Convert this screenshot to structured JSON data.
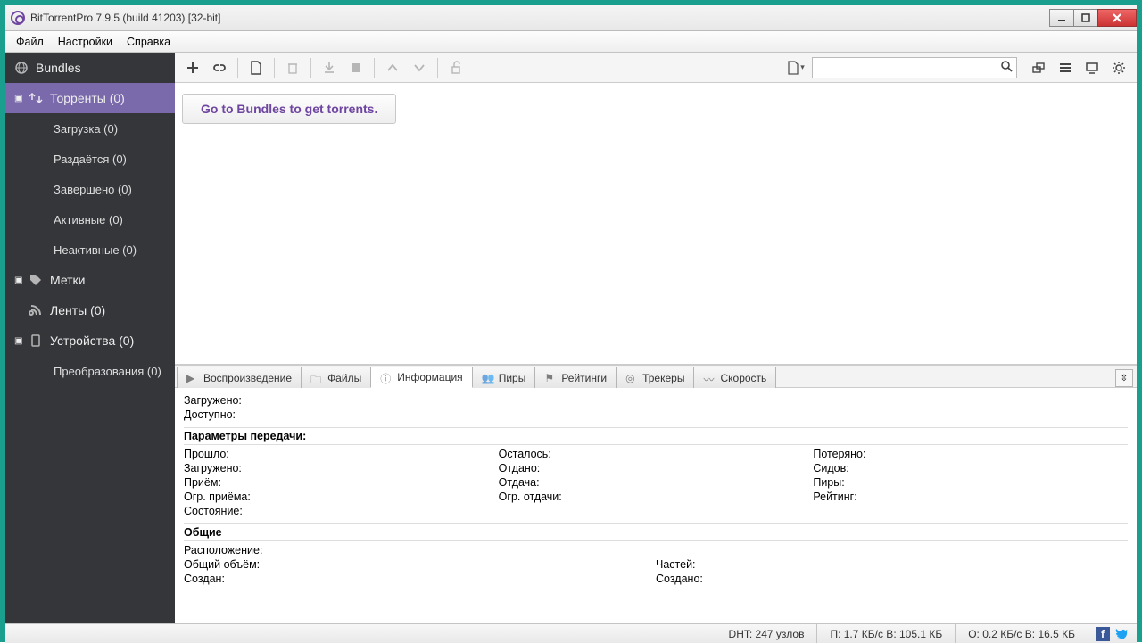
{
  "window": {
    "title": "BitTorrentPro 7.9.5  (build 41203) [32-bit]"
  },
  "menu": {
    "file": "Файл",
    "settings": "Настройки",
    "help": "Справка"
  },
  "sidebar": {
    "bundles": "Bundles",
    "torrents": "Торренты (0)",
    "sub": {
      "downloading": "Загрузка (0)",
      "seeding": "Раздаётся (0)",
      "completed": "Завершено (0)",
      "active": "Активные (0)",
      "inactive": "Неактивные (0)"
    },
    "labels": "Метки",
    "feeds": "Ленты (0)",
    "devices": "Устройства (0)",
    "conversions": "Преобразования (0)"
  },
  "banner": "Go to Bundles to get torrents.",
  "tabs": {
    "playback": "Воспроизведение",
    "files": "Файлы",
    "info": "Информация",
    "peers": "Пиры",
    "ratings": "Рейтинги",
    "trackers": "Трекеры",
    "speed": "Скорость"
  },
  "toprows": {
    "downloaded": "Загружено:",
    "avail": "Доступно:"
  },
  "transfer": {
    "head": "Параметры передачи:",
    "elapsed": "Прошло:",
    "remaining": "Осталось:",
    "wasted": "Потеряно:",
    "downloaded": "Загружено:",
    "uploaded": "Отдано:",
    "seeds": "Сидов:",
    "dlspeed": "Приём:",
    "ulspeed": "Отдача:",
    "peers": "Пиры:",
    "dllimit": "Огр. приёма:",
    "ullimit": "Огр. отдачи:",
    "rating": "Рейтинг:",
    "status": "Состояние:"
  },
  "general": {
    "head": "Общие",
    "location": "Расположение:",
    "size": "Общий объём:",
    "pieces": "Частей:",
    "created": "Создан:",
    "createdon": "Создано:"
  },
  "status": {
    "dht": "DHT: 247 узлов",
    "down": "П: 1.7 КБ/с В: 105.1 КБ",
    "up": "О: 0.2 КБ/с В: 16.5 КБ"
  }
}
